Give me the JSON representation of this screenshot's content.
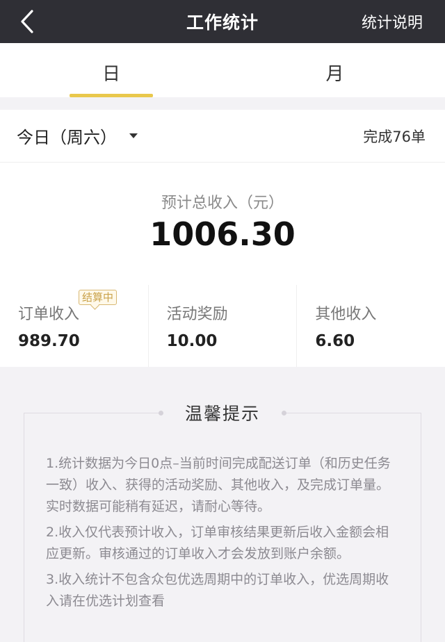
{
  "header": {
    "title": "工作统计",
    "explain_label": "统计说明"
  },
  "tabs": [
    {
      "label": "日",
      "active": true
    },
    {
      "label": "月",
      "active": false
    }
  ],
  "date_row": {
    "selected_day": "今日（周六）",
    "completed": "完成76单"
  },
  "summary": {
    "total_label": "预计总收入（元）",
    "total_value": "1006.30",
    "metrics": [
      {
        "label": "订单收入",
        "value": "989.70",
        "badge": "结算中"
      },
      {
        "label": "活动奖励",
        "value": "10.00"
      },
      {
        "label": "其他收入",
        "value": "6.60"
      }
    ]
  },
  "tips": {
    "title": "温馨提示",
    "items": [
      "1.统计数据为今日0点–当前时间完成配送订单（和历史任务一致）收入、获得的活动奖励、其他收入，及完成订单量。实时数据可能稍有延迟，请耐心等待。",
      "2.收入仅代表预计收入，订单审核结果更新后收入金额会相应更新。审核通过的订单收入才会发放到账户余额。",
      "3.收入统计不包含众包优选周期中的订单收入，优选周期收入请在优选计划查看"
    ]
  },
  "colors": {
    "topbar": "#2f2f35",
    "accent": "#e9c84c",
    "badge": "#c9a24a"
  }
}
